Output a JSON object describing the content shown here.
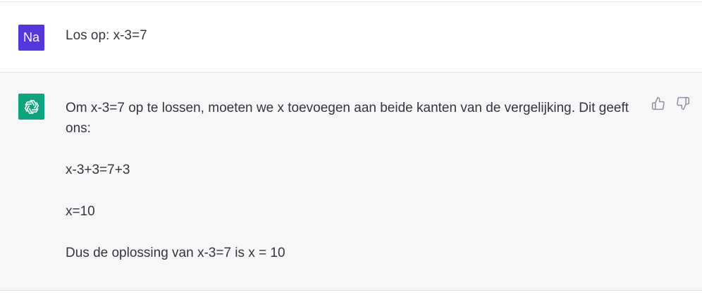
{
  "conversation": {
    "user_message": {
      "avatar_initials": "Na",
      "text": "Los op: x-3=7"
    },
    "assistant_message": {
      "paragraphs": [
        "Om x-3=7 op te lossen, moeten we x toevoegen aan beide kanten van de vergelijking. Dit geeft ons:",
        "x-3+3=7+3",
        "x=10",
        "Dus de oplossing van x-3=7 is x = 10"
      ],
      "feedback_icons": [
        "thumbs-up-icon",
        "thumbs-down-icon"
      ]
    }
  },
  "colors": {
    "user_avatar_bg": "#5436da",
    "assistant_avatar_bg": "#10a37f",
    "assistant_row_bg": "#f7f7f8",
    "text": "#343541"
  }
}
